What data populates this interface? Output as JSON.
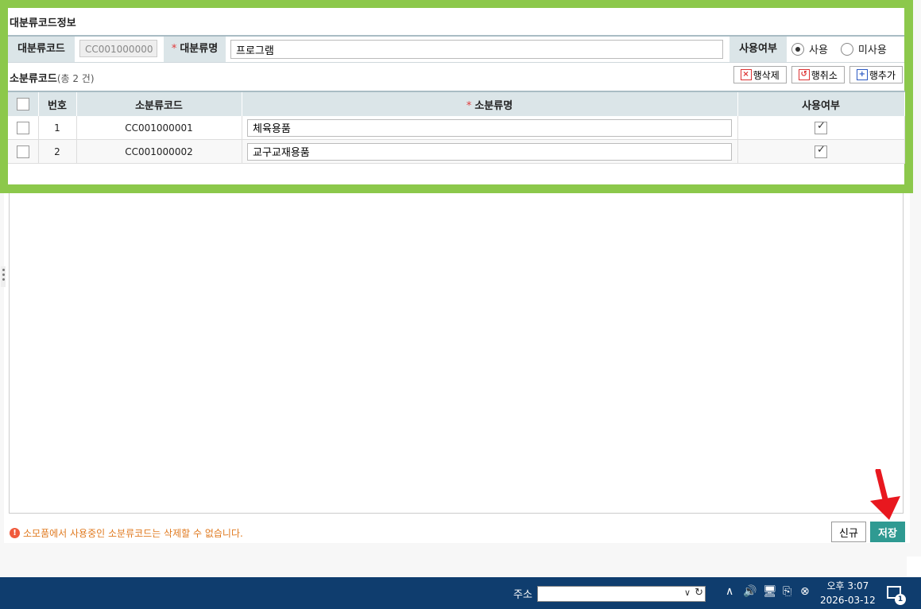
{
  "section": {
    "title": "대분류코드정보",
    "code_label": "대분류코드",
    "code_value": "CC001000000",
    "name_label": "대분류명",
    "name_value": "프로그램",
    "use_label": "사용여부",
    "use_options": [
      "사용",
      "미사용"
    ],
    "use_selected": "사용"
  },
  "sub": {
    "title": "소분류코드",
    "count_text": "(총  2  건)",
    "buttons": {
      "delete_row": "행삭제",
      "cancel_row": "행취소",
      "add_row": "행추가"
    }
  },
  "grid": {
    "headers": {
      "no": "번호",
      "code": "소분류코드",
      "name": "소분류명",
      "use": "사용여부"
    },
    "rows": [
      {
        "no": "1",
        "code": "CC001000001",
        "name": "체육용품",
        "use": true
      },
      {
        "no": "2",
        "code": "CC001000002",
        "name": "교구교재용품",
        "use": true
      }
    ]
  },
  "notice": "소모품에서 사용중인 소분류코드는 삭제할 수 없습니다.",
  "footer": {
    "new_label": "신규",
    "save_label": "저장"
  },
  "taskbar": {
    "address_label": "주소",
    "address_value": "",
    "time": "오후 3:07",
    "date": "2026-03-12",
    "notif_count": "1"
  },
  "colors": {
    "frame": "#8cc84b",
    "header_bg": "#dbe5e8",
    "save_bg": "#2f9a92",
    "taskbar": "#0f3d6e",
    "arrow": "#e8181f"
  }
}
